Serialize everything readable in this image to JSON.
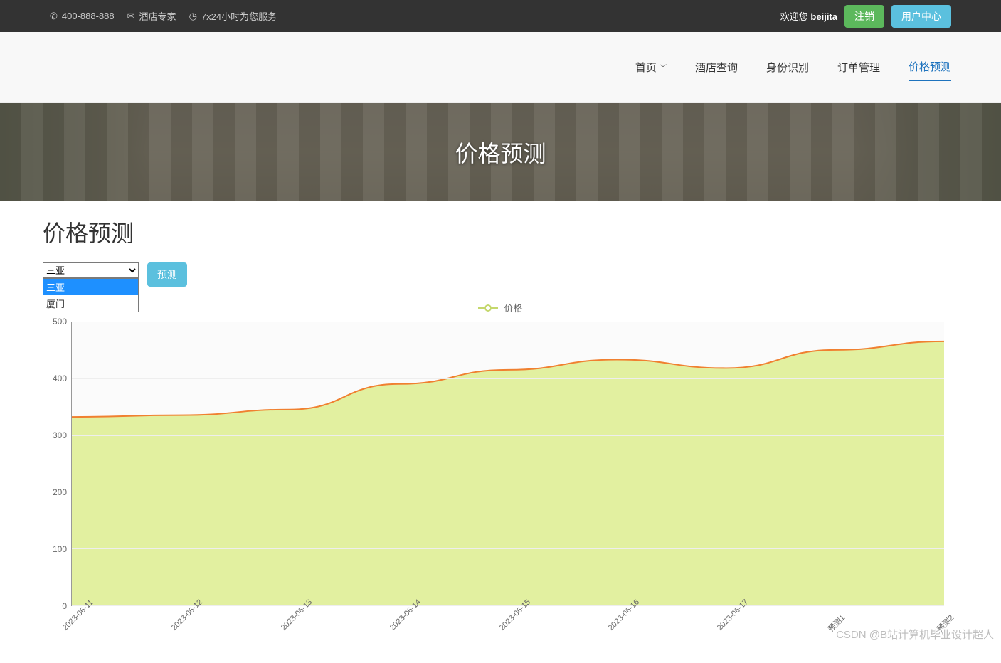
{
  "topbar": {
    "phone": "400-888-888",
    "expert": "酒店专家",
    "service": "7x24小时为您服务",
    "welcome_prefix": "欢迎您",
    "username": "beijita",
    "logout": "注销",
    "user_center": "用户中心"
  },
  "nav": {
    "items": [
      {
        "label": "首页",
        "has_chevron": true
      },
      {
        "label": "酒店查询"
      },
      {
        "label": "身份识别"
      },
      {
        "label": "订单管理"
      },
      {
        "label": "价格预测",
        "active": true
      }
    ]
  },
  "hero": {
    "title": "价格预测"
  },
  "page": {
    "title": "价格预测"
  },
  "controls": {
    "selected": "三亚",
    "options": [
      "三亚",
      "厦门"
    ],
    "predict_btn": "预测"
  },
  "legend": {
    "series_name": "价格"
  },
  "chart_data": {
    "type": "area",
    "title": "",
    "xlabel": "",
    "ylabel": "",
    "ylim": [
      0,
      500
    ],
    "yticks": [
      0,
      100,
      200,
      300,
      400,
      500
    ],
    "categories": [
      "2023-06-11",
      "2023-06-12",
      "2023-06-13",
      "2023-06-14",
      "2023-06-15",
      "2023-06-16",
      "2023-06-17",
      "预测1",
      "预测2"
    ],
    "series": [
      {
        "name": "价格",
        "values": [
          332,
          335,
          345,
          390,
          415,
          433,
          418,
          450,
          465
        ]
      }
    ],
    "colors": {
      "fill": "#e2f0a0",
      "stroke": "#f08030"
    }
  },
  "watermark": "CSDN @B站计算机毕业设计超人"
}
